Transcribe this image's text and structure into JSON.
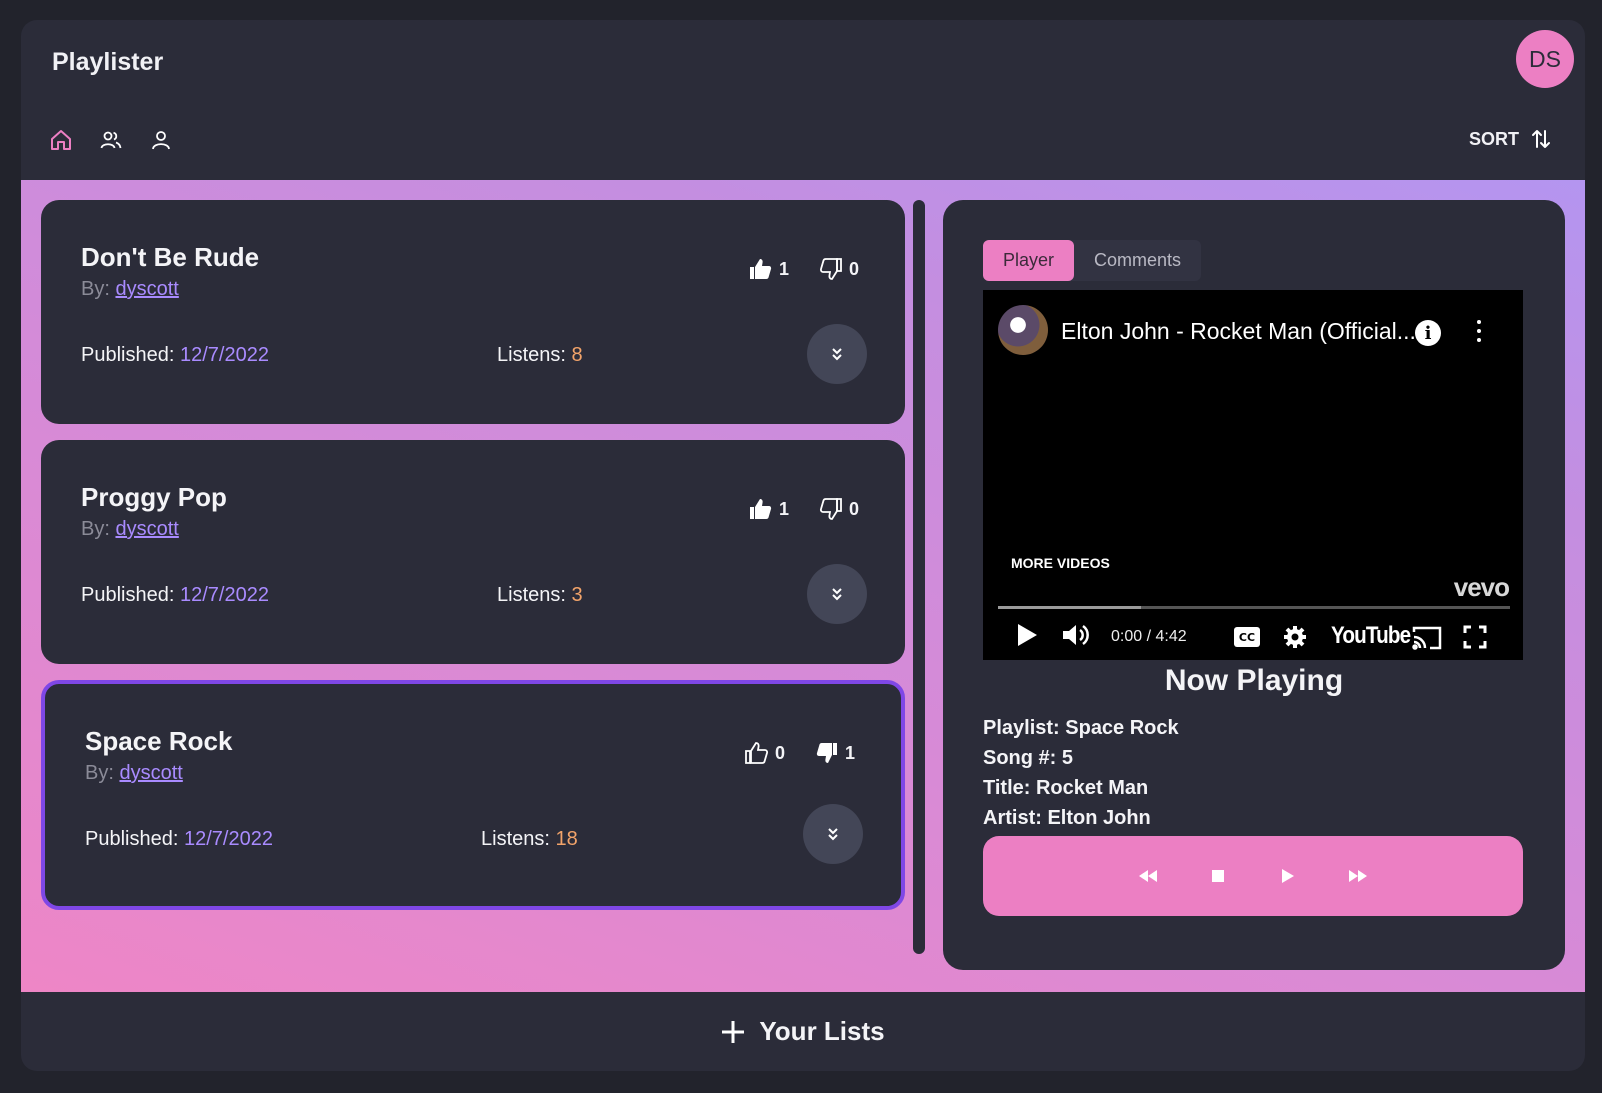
{
  "app": {
    "title": "Playlister",
    "user_initials": "DS",
    "accent_color": "#ec7fc3",
    "link_color": "#a98bff",
    "selected_border_color": "#7f47e6"
  },
  "toolbar": {
    "icons": [
      "home-icon",
      "groups-icon",
      "user-icon"
    ],
    "sort_label": "SORT",
    "sort_icon": "sort-arrows-icon"
  },
  "playlists": [
    {
      "title": "Don't Be Rude",
      "by_label": "By:",
      "author": "dyscott",
      "likes": "1",
      "dislikes": "0",
      "published_label": "Published:",
      "published": "12/7/2022",
      "listens_label": "Listens:",
      "listens": "8",
      "selected": false
    },
    {
      "title": "Proggy Pop",
      "by_label": "By:",
      "author": "dyscott",
      "likes": "1",
      "dislikes": "0",
      "published_label": "Published:",
      "published": "12/7/2022",
      "listens_label": "Listens:",
      "listens": "3",
      "selected": false
    },
    {
      "title": "Space Rock",
      "by_label": "By:",
      "author": "dyscott",
      "likes": "0",
      "dislikes": "1",
      "published_label": "Published:",
      "published": "12/7/2022",
      "listens_label": "Listens:",
      "listens": "18",
      "selected": true
    }
  ],
  "panel": {
    "tabs": [
      "Player",
      "Comments"
    ],
    "active_tab": "Player",
    "video": {
      "title": "Elton John - Rocket Man (Official...",
      "more_videos": "MORE VIDEOS",
      "brand": "vevo",
      "time": "0:00 / 4:42",
      "platform": "YouTube"
    },
    "now_playing": {
      "heading": "Now Playing",
      "playlist": "Playlist: Space Rock",
      "song_number": "Song #: 5",
      "title": "Title: Rocket Man",
      "artist": "Artist: Elton John"
    }
  },
  "footer": {
    "add_label": "Your Lists"
  }
}
